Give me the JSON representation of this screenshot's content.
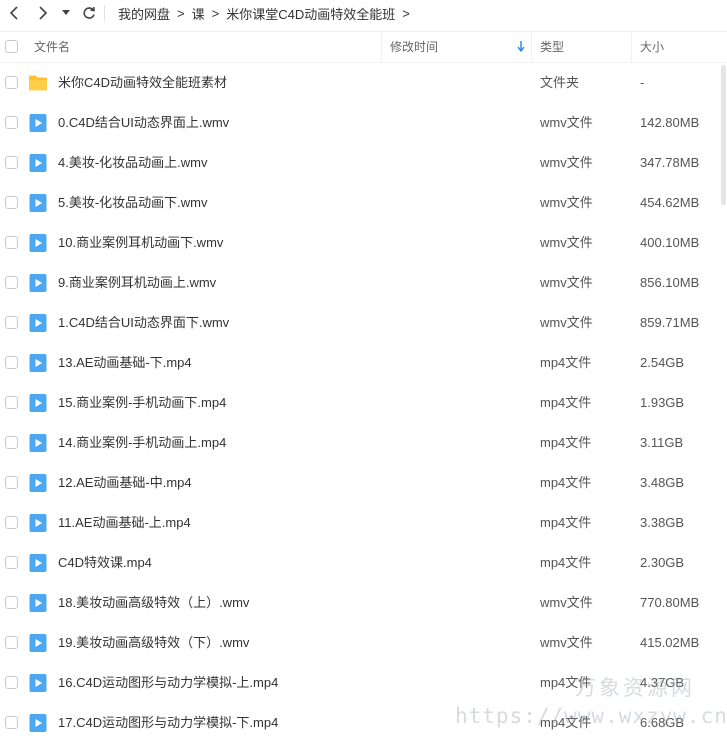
{
  "breadcrumb": [
    "我的网盘",
    "课",
    "米你课堂C4D动画特效全能班"
  ],
  "breadcrumb_separator": ">",
  "header": {
    "name": "文件名",
    "modified": "修改时间",
    "type": "类型",
    "size": "大小"
  },
  "files": [
    {
      "name": "米你C4D动画特效全能班素材",
      "type": "文件夹",
      "size": "-",
      "icon": "folder-icon"
    },
    {
      "name": "0.C4D结合UI动态界面上.wmv",
      "type": "wmv文件",
      "size": "142.80MB",
      "icon": "video-file-icon"
    },
    {
      "name": "4.美妆-化妆品动画上.wmv",
      "type": "wmv文件",
      "size": "347.78MB",
      "icon": "video-file-icon"
    },
    {
      "name": "5.美妆-化妆品动画下.wmv",
      "type": "wmv文件",
      "size": "454.62MB",
      "icon": "video-file-icon"
    },
    {
      "name": "10.商业案例耳机动画下.wmv",
      "type": "wmv文件",
      "size": "400.10MB",
      "icon": "video-file-icon"
    },
    {
      "name": "9.商业案例耳机动画上.wmv",
      "type": "wmv文件",
      "size": "856.10MB",
      "icon": "video-file-icon"
    },
    {
      "name": "1.C4D结合UI动态界面下.wmv",
      "type": "wmv文件",
      "size": "859.71MB",
      "icon": "video-file-icon"
    },
    {
      "name": "13.AE动画基础-下.mp4",
      "type": "mp4文件",
      "size": "2.54GB",
      "icon": "video-file-icon"
    },
    {
      "name": "15.商业案例-手机动画下.mp4",
      "type": "mp4文件",
      "size": "1.93GB",
      "icon": "video-file-icon"
    },
    {
      "name": "14.商业案例-手机动画上.mp4",
      "type": "mp4文件",
      "size": "3.11GB",
      "icon": "video-file-icon"
    },
    {
      "name": "12.AE动画基础-中.mp4",
      "type": "mp4文件",
      "size": "3.48GB",
      "icon": "video-file-icon"
    },
    {
      "name": "11.AE动画基础-上.mp4",
      "type": "mp4文件",
      "size": "3.38GB",
      "icon": "video-file-icon"
    },
    {
      "name": "C4D特效课.mp4",
      "type": "mp4文件",
      "size": "2.30GB",
      "icon": "video-file-icon"
    },
    {
      "name": "18.美妆动画高级特效（上）.wmv",
      "type": "wmv文件",
      "size": "770.80MB",
      "icon": "video-file-icon"
    },
    {
      "name": "19.美妆动画高级特效（下）.wmv",
      "type": "wmv文件",
      "size": "415.02MB",
      "icon": "video-file-icon"
    },
    {
      "name": "16.C4D运动图形与动力学模拟-上.mp4",
      "type": "mp4文件",
      "size": "4.37GB",
      "icon": "video-file-icon"
    },
    {
      "name": "17.C4D运动图形与动力学模拟-下.mp4",
      "type": "mp4文件",
      "size": "6.68GB",
      "icon": "video-file-icon"
    }
  ],
  "watermark": {
    "line1": "万象资源网",
    "line2": "https://www.wxzyw.cn"
  },
  "colors": {
    "accent": "#1e88e5",
    "folder": "#fdc02e",
    "video": "#4aa8f5"
  }
}
